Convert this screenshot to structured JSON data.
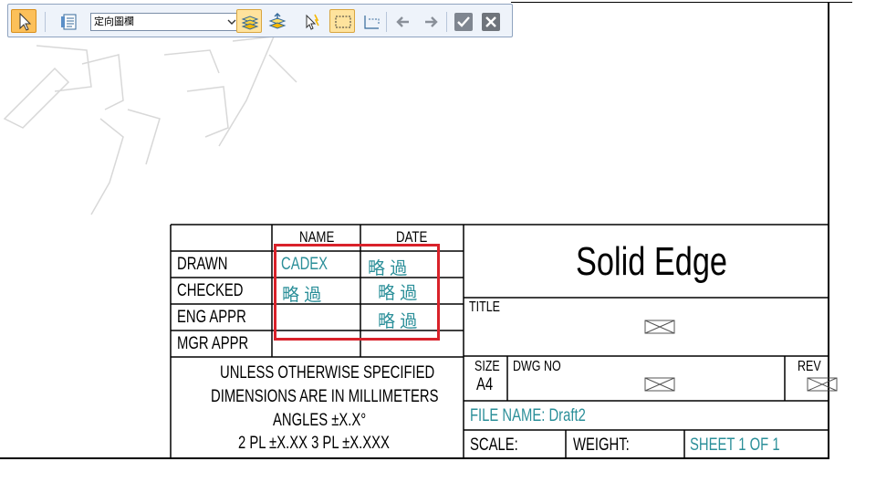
{
  "toolbar": {
    "select_tool": "select-arrow",
    "view_dropdown_value": "定向圖欄",
    "buttons": [
      "select-arrow",
      "properties-list",
      "layers-stacked",
      "layers-up",
      "smart-select",
      "rect-select",
      "line-select",
      "back",
      "forward",
      "accept",
      "cancel"
    ]
  },
  "titleblock": {
    "header_name": "NAME",
    "header_date": "DATE",
    "row_drawn": "DRAWN",
    "row_checked": "CHECKED",
    "row_eng": "ENG APPR",
    "row_mgr": "MGR APPR",
    "drawn_name": "CADEX",
    "drawn_date": "略 過",
    "checked_name": "略 過",
    "checked_date": "略 過",
    "eng_date": "略 過",
    "notes": [
      "UNLESS OTHERWISE SPECIFIED",
      "DIMENSIONS ARE IN MILLIMETERS",
      "ANGLES ±X.X°",
      "2 PL ±X.XX 3 PL ±X.XXX"
    ],
    "company": "Solid Edge",
    "title_label": "TITLE",
    "size_label": "SIZE",
    "size_value": "A4",
    "dwg_label": "DWG NO",
    "rev_label": "REV",
    "file_name": "FILE NAME: Draft2",
    "scale_label": "SCALE:",
    "weight_label": "WEIGHT:",
    "sheet": "SHEET 1 OF 1"
  },
  "colors": {
    "field_text": "#2b8f99",
    "highlight": "#d9222a",
    "toolbar_active": "#fcc05a"
  }
}
